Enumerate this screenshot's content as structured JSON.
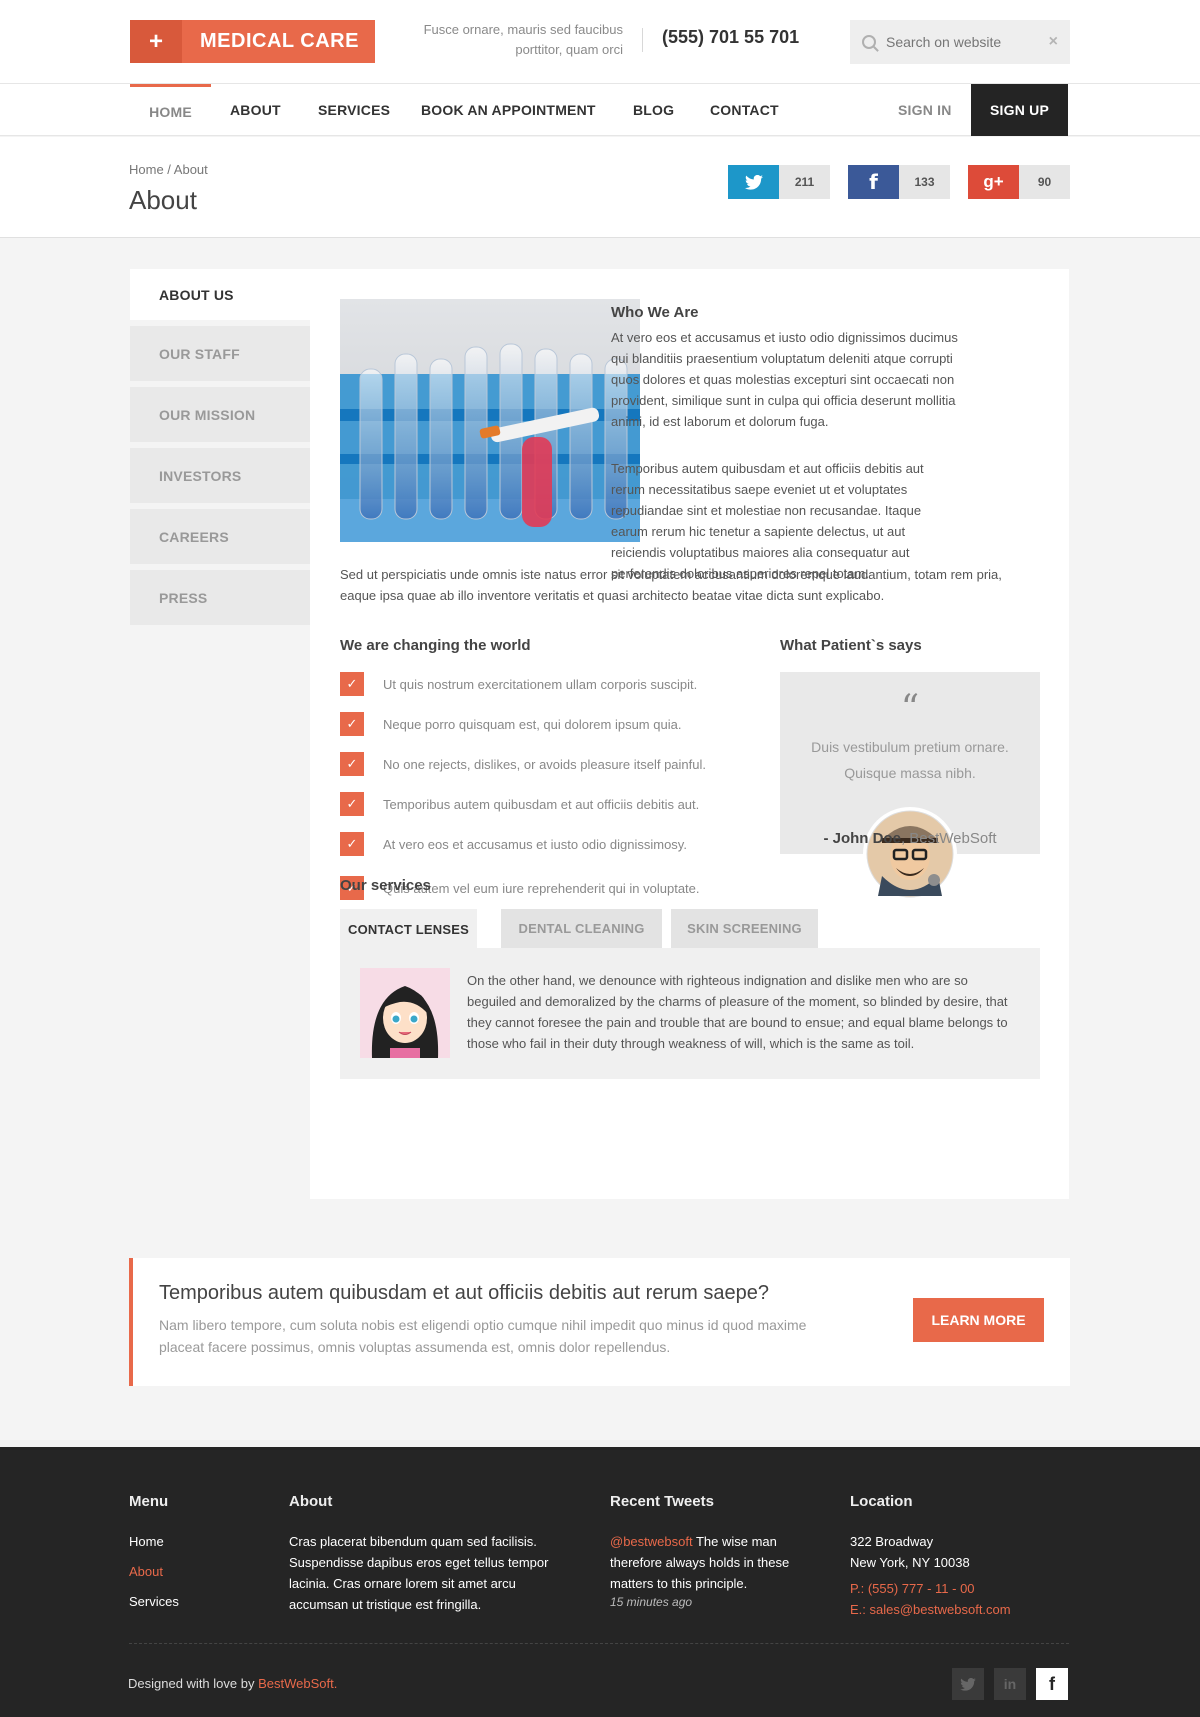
{
  "brand": {
    "name": "MEDICAL CARE",
    "plus": "+",
    "tagline": "Fusce ornare, mauris sed faucibus porttitor, quam orci",
    "phone": "(555) 701 55 701"
  },
  "search": {
    "placeholder": "Search on website",
    "clear": "×"
  },
  "nav": {
    "items": [
      "HOME",
      "ABOUT",
      "SERVICES",
      "BOOK AN APPOINTMENT",
      "BLOG",
      "CONTACT"
    ],
    "active": "HOME",
    "signin": "SIGN IN",
    "signup": "SIGN UP"
  },
  "breadcrumb": "Home / About",
  "page_title": "About",
  "shares": [
    {
      "network": "twitter",
      "icon": "twitter-icon",
      "count": "211",
      "color": "#1d97c9"
    },
    {
      "network": "facebook",
      "icon": "facebook-icon",
      "count": "133",
      "color": "#3b5998"
    },
    {
      "network": "google-plus",
      "icon": "google-plus-icon",
      "count": "90",
      "color": "#dd4b39"
    }
  ],
  "sidebar": {
    "items": [
      "ABOUT US",
      "OUR STAFF",
      "OUR MISSION",
      "INVESTORS",
      "CAREERS",
      "PRESS"
    ],
    "active": "ABOUT US"
  },
  "who": {
    "title": "Who We Are",
    "p1": "At vero eos et accusamus et iusto odio dignissimos ducimus qui blanditiis praesentium voluptatum deleniti atque corrupti quos dolores et quas molestias excepturi sint occaecati non provident, similique sunt in culpa qui officia deserunt mollitia animi, id est laborum et dolorum fuga.",
    "p2": "Temporibus autem quibusdam et aut officiis debitis aut rerum necessitatibus saepe eveniet ut et voluptates repudiandae sint et molestiae non recusandae. Itaque earum rerum hic tenetur a sapiente delectus, ut aut reiciendis voluptatibus maiores alia consequatur aut perferendis doloribus asperiores repel totam.",
    "p3": "Sed ut perspiciatis unde omnis iste natus error sit voluptatem accusantium doloremque laudantium, totam rem pria, eaque ipsa quae ab illo inventore veritatis et quasi architecto beatae vitae dicta sunt explicabo."
  },
  "changing": {
    "title": "We are changing the world",
    "items": [
      "Ut quis nostrum exercitationem ullam corporis suscipit.",
      "Neque porro quisquam est, qui dolorem ipsum quia.",
      "No one rejects, dislikes, or avoids pleasure itself painful.",
      "Temporibus autem quibusdam et aut officiis debitis aut.",
      "At vero eos et accusamus et iusto odio dignissimosy.",
      "Quis autem vel eum iure reprehenderit qui in voluptate."
    ]
  },
  "testimonial": {
    "title": "What Patient`s says",
    "quote_mark": "“",
    "text": "Duis vestibulum pretium ornare. Quisque massa nibh.",
    "author": "- John Doe",
    "company": ", BestWebSoft"
  },
  "services": {
    "title": "Our services",
    "tabs": [
      "CONTACT LENSES",
      "DENTAL CLEANING",
      "SKIN SCREENING"
    ],
    "active": "CONTACT LENSES",
    "text": "On the other hand, we denounce with righteous indignation and dislike men who are so beguiled and demoralized by the charms of pleasure of the moment, so blinded by desire, that they cannot foresee the pain and trouble that are bound to ensue; and equal blame belongs to those who fail in their duty through weakness of will, which is the same as toil."
  },
  "cta": {
    "title": "Temporibus autem quibusdam et aut officiis debitis aut rerum saepe?",
    "text": "Nam libero tempore, cum soluta nobis est eligendi optio cumque nihil impedit quo minus id quod maxime placeat facere possimus, omnis voluptas assumenda est, omnis dolor repellendus.",
    "button": "LEARN MORE"
  },
  "footer": {
    "menu": {
      "title": "Menu",
      "items": [
        "Home",
        "About",
        "Services"
      ],
      "active": "About"
    },
    "about": {
      "title": "About",
      "text": "Cras placerat bibendum quam sed facilisis. Suspendisse dapibus eros eget tellus tempor lacinia. Cras ornare lorem sit amet arcu accumsan ut tristique est fringilla."
    },
    "tweets": {
      "title": "Recent Tweets",
      "handle": "@bestwebsoft",
      "text": " The wise man therefore always holds in these matters to this principle.",
      "time": "15 minutes ago"
    },
    "location": {
      "title": "Location",
      "line1": "322 Broadway",
      "line2": "New York, NY 10038",
      "phone": "P.: (555) 777 - 11 - 00",
      "email": "E.: sales@bestwebsoft.com"
    },
    "credit_prefix": "Designed with love by ",
    "credit_link": "BestWebSoft.",
    "social": [
      "twitter-icon",
      "linkedin-icon",
      "facebook-icon"
    ]
  },
  "colors": {
    "accent": "#e8694a",
    "dark": "#252525"
  }
}
